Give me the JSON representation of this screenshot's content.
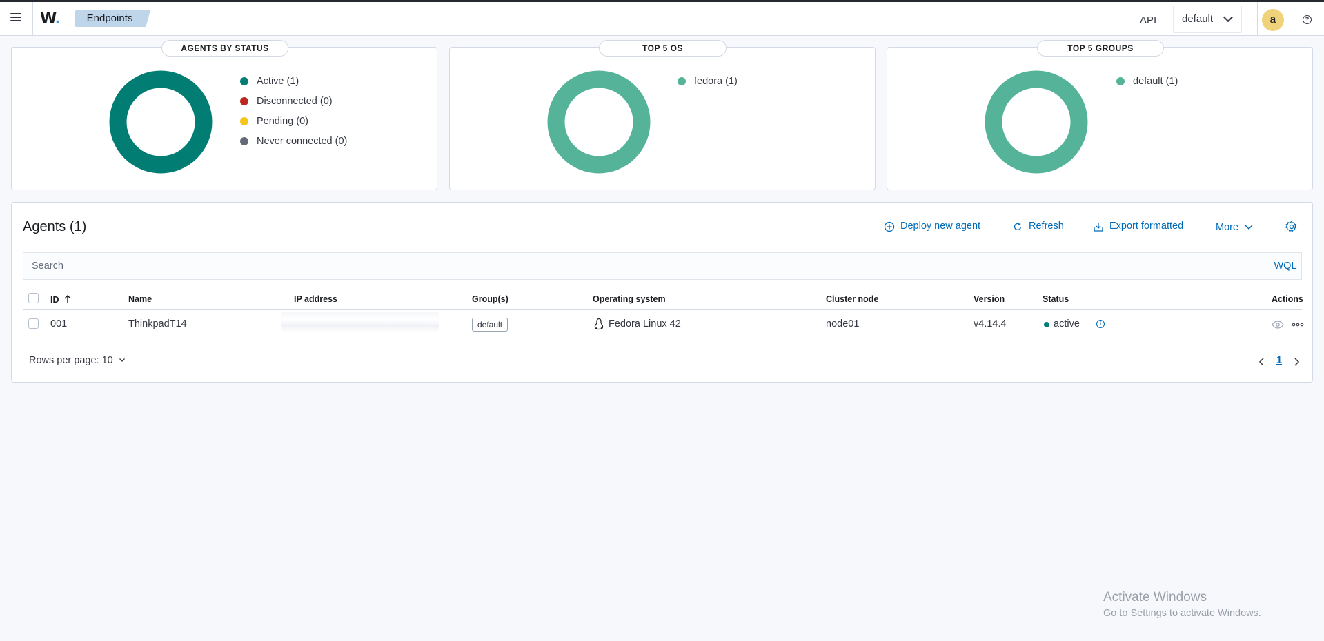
{
  "header": {
    "logo": "W",
    "breadcrumb": "Endpoints",
    "api_label": "API",
    "environment": "default",
    "avatar_letter": "a",
    "help": "?"
  },
  "cards": {
    "status": {
      "title": "AGENTS BY STATUS",
      "legend": [
        {
          "label": "Active (1)",
          "color": "#017d73"
        },
        {
          "label": "Disconnected (0)",
          "color": "#bd271e"
        },
        {
          "label": "Pending (0)",
          "color": "#f5c518"
        },
        {
          "label": "Never connected (0)",
          "color": "#646a77"
        }
      ],
      "ring_color": "#017d73"
    },
    "os": {
      "title": "TOP 5 OS",
      "legend": [
        {
          "label": "fedora (1)",
          "color": "#54b399"
        }
      ],
      "ring_color": "#54b399"
    },
    "groups": {
      "title": "TOP 5 GROUPS",
      "legend": [
        {
          "label": "default (1)",
          "color": "#54b399"
        }
      ],
      "ring_color": "#54b399"
    }
  },
  "agents": {
    "title": "Agents (1)",
    "actions": {
      "deploy": "Deploy new agent",
      "refresh": "Refresh",
      "export": "Export formatted",
      "more": "More"
    },
    "search_placeholder": "Search",
    "wql": "WQL",
    "columns": {
      "id": "ID",
      "name": "Name",
      "ip": "IP address",
      "groups": "Group(s)",
      "os": "Operating system",
      "node": "Cluster node",
      "version": "Version",
      "status": "Status",
      "actions": "Actions"
    },
    "rows": [
      {
        "id": "001",
        "name": "ThinkpadT14",
        "group": "default",
        "os": "Fedora Linux 42",
        "node": "node01",
        "version": "v4.14.4",
        "status": "active"
      }
    ],
    "rows_per_page": "Rows per page: 10",
    "current_page": "1"
  },
  "watermark": {
    "line1": "Activate Windows",
    "line2": "Go to Settings to activate Windows."
  }
}
